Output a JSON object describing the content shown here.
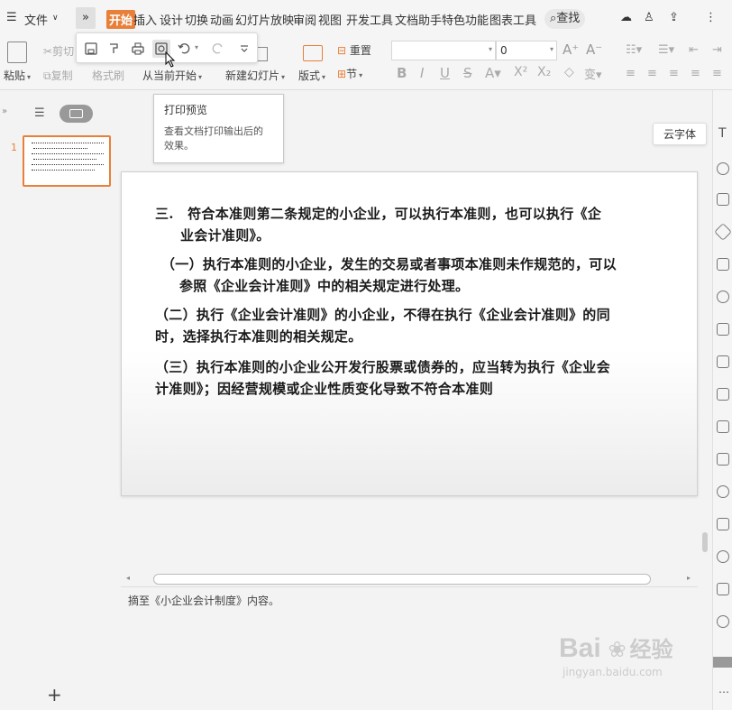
{
  "menu": {
    "file_label": "文件",
    "tabs": [
      {
        "label": "开始",
        "active": true
      },
      {
        "label": "插入"
      },
      {
        "label": "设计"
      },
      {
        "label": "切换"
      },
      {
        "label": "动画"
      },
      {
        "label": "幻灯片放映"
      },
      {
        "label": "审阅"
      },
      {
        "label": "视图"
      },
      {
        "label": "开发工具"
      },
      {
        "label": "文档助手"
      },
      {
        "label": "特色功能"
      },
      {
        "label": "图表工具"
      }
    ],
    "search_label": "查找"
  },
  "ribbon": {
    "paste_label": "粘贴",
    "cut_label": "剪切",
    "copy_label": "复制",
    "format_painter_label": "格式刷",
    "from_current_label": "从当前开始",
    "new_slide_label": "新建幻灯片",
    "layout_label": "版式",
    "section_label": "节",
    "reset_label": "重置",
    "font_size_value": "0"
  },
  "tooltip": {
    "title": "打印预览",
    "description_line1": "查看文档打印输出后的",
    "description_line2": "效果。"
  },
  "cloud_font_tip": "云字体",
  "slide_panel": {
    "slide_number": "1"
  },
  "slide": {
    "paragraphs": [
      {
        "line1": "三.　符合本准则第二条规定的小企业，可以执行本准则，也可以执行《企",
        "line2": "业会计准则》。"
      },
      {
        "line1": "（一）执行本准则的小企业，发生的交易或者事项本准则未作规范的，可以",
        "line2": "参照《企业会计准则》中的相关规定进行处理。"
      },
      {
        "line1": "（二）执行《企业会计准则》的小企业，不得在执行《企业会计准则》的同",
        "line2": "时，选择执行本准则的相关规定。"
      },
      {
        "line1": "（三）执行本准则的小企业公开发行股票或债券的，应当转为执行《企业会",
        "line2": "计准则》；因经营规模或企业性质变化导致不符合本准则"
      }
    ]
  },
  "notes_text": "摘至《小企业会计制度》内容。",
  "watermark": {
    "brand": "Bai",
    "brand2": "经验",
    "url": "jingyan.baidu.com"
  },
  "colors": {
    "accent": "#e8803a"
  }
}
